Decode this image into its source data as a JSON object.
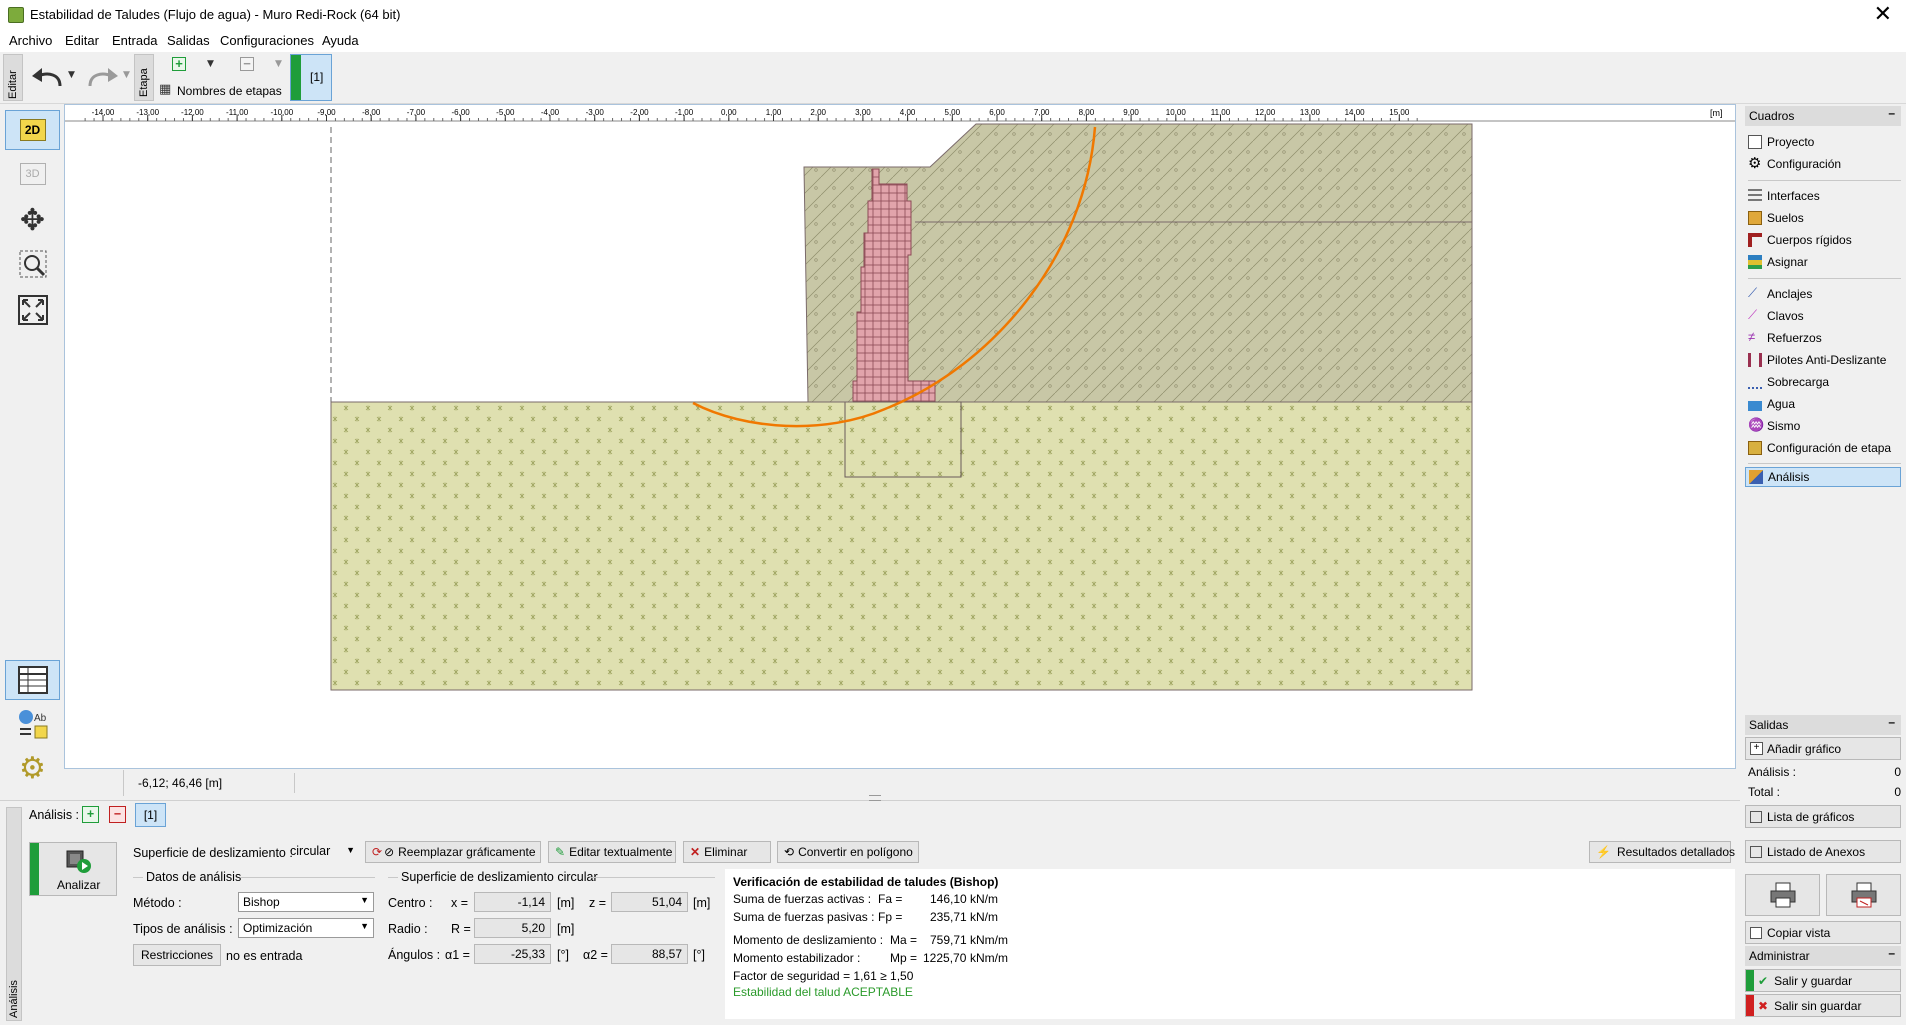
{
  "window": {
    "title": "Estabilidad de Taludes (Flujo de agua) - Muro Redi-Rock  (64 bit)"
  },
  "menu": [
    "Archivo",
    "Editar",
    "Entrada",
    "Salidas",
    "Configuraciones",
    "Ayuda"
  ],
  "toolbar": {
    "edit_tab": "Editar",
    "stage_tab": "Etapa",
    "stage_names_label": "Nombres de etapas",
    "stage_current": "[1]"
  },
  "left_tools": {
    "view_2d": "2D",
    "view_3d": "3D"
  },
  "ruler": {
    "ticks": [
      "-14,00",
      "-13,00",
      "-12,00",
      "-11,00",
      "-10,00",
      "-9,00",
      "-8,00",
      "-7,00",
      "-6,00",
      "-5,00",
      "-4,00",
      "-3,00",
      "-2,00",
      "-1,00",
      "0,00",
      "1,00",
      "2,00",
      "3,00",
      "4,00",
      "5,00",
      "6,00",
      "7,00",
      "8,00",
      "9,00",
      "10,00",
      "11,00",
      "12,00",
      "13,00",
      "14,00",
      "15,00"
    ],
    "unit": "[m]"
  },
  "status": {
    "coordinates": "-6,12; 46,46 [m]"
  },
  "right_panel": {
    "cuadros_title": "Cuadros",
    "items_group1": [
      {
        "label": "Proyecto",
        "icon": "document-icon"
      },
      {
        "label": "Configuración",
        "icon": "gear-icon"
      }
    ],
    "items_group2": [
      {
        "label": "Interfaces",
        "icon": "interfaces-icon"
      },
      {
        "label": "Suelos",
        "icon": "soil-icon"
      },
      {
        "label": "Cuerpos rígidos",
        "icon": "rigid-body-icon"
      },
      {
        "label": "Asignar",
        "icon": "assign-icon"
      }
    ],
    "items_group3": [
      {
        "label": "Anclajes",
        "icon": "anchor-icon"
      },
      {
        "label": "Clavos",
        "icon": "nail-icon"
      },
      {
        "label": "Refuerzos",
        "icon": "reinforcement-icon"
      },
      {
        "label": "Pilotes Anti-Deslizante",
        "icon": "pile-icon"
      },
      {
        "label": "Sobrecarga",
        "icon": "surcharge-icon"
      },
      {
        "label": "Agua",
        "icon": "water-icon"
      },
      {
        "label": "Sismo",
        "icon": "earthquake-icon"
      },
      {
        "label": "Configuración de etapa",
        "icon": "stage-settings-icon"
      }
    ],
    "selected_item": {
      "label": "Análisis",
      "icon": "analysis-icon"
    },
    "salidas_title": "Salidas",
    "add_graph": "Añadir gráfico",
    "analysis_count_label": "Análisis :",
    "analysis_count": "0",
    "total_label": "Total :",
    "total": "0",
    "graph_list": "Lista de gráficos",
    "annex_list": "Listado de Anexos",
    "copy_view": "Copiar vista",
    "admin_title": "Administrar",
    "exit_save": "Salir y guardar",
    "exit_nosave": "Salir sin guardar"
  },
  "bottom": {
    "side_tab": "Análisis",
    "analysis_label": "Análisis :",
    "analysis_tab": "[1]",
    "analyze_button": "Analizar",
    "slip_surface_label": "Superficie de deslizamiento :",
    "slip_surface_value": "circular",
    "replace_graphically": "Reemplazar gráficamente",
    "edit_textually": "Editar textualmente",
    "delete": "Eliminar",
    "convert_polygon": "Convertir en polígono",
    "detailed_results": "Resultados detallados",
    "analysis_data_title": "Datos de análisis",
    "method_label": "Método :",
    "method_value": "Bishop",
    "analysis_type_label": "Tipos de análisis :",
    "analysis_type_value": "Optimización",
    "restrictions_button": "Restricciones",
    "restrictions_value": "no es entrada",
    "circular_title": "Superficie de deslizamiento circular",
    "center_label": "Centro :",
    "x_label": "x =",
    "x_value": "-1,14",
    "x_unit": "[m]",
    "z_label": "z =",
    "z_value": "51,04",
    "z_unit": "[m]",
    "radius_label": "Radio :",
    "r_label": "R =",
    "r_value": "5,20",
    "r_unit": "[m]",
    "angles_label": "Ángulos :",
    "a1_label": "α1 =",
    "a1_value": "-25,33",
    "a1_unit": "[°]",
    "a2_label": "α2 =",
    "a2_value": "88,57",
    "a2_unit": "[°]"
  },
  "results": {
    "title": "Verificación de estabilidad de taludes (Bishop)",
    "fa_label": "Suma de fuerzas activas :",
    "fa_sym": "Fa =",
    "fa_value": "146,10",
    "fa_unit": "kN/m",
    "fp_label": "Suma de fuerzas pasivas :",
    "fp_sym": "Fp =",
    "fp_value": "235,71",
    "fp_unit": "kN/m",
    "ma_label": "Momento de deslizamiento :",
    "ma_sym": "Ma =",
    "ma_value": "759,71",
    "ma_unit": "kNm/m",
    "mp_label": "Momento estabilizador :",
    "mp_sym": "Mp =",
    "mp_value": "1225,70",
    "mp_unit": "kNm/m",
    "fs_line": "Factor de seguridad = 1,61 ≥ 1,50",
    "verdict": "Estabilidad del talud ACEPTABLE",
    "verdict_color": "#2a9a2a"
  },
  "colors": {
    "accent_green": "#1f9d3a",
    "soil_upper": "#c8c7a6",
    "soil_lower": "#dfe0b0",
    "wall": "#e1a4ab",
    "slip_surface": "#f07800"
  }
}
